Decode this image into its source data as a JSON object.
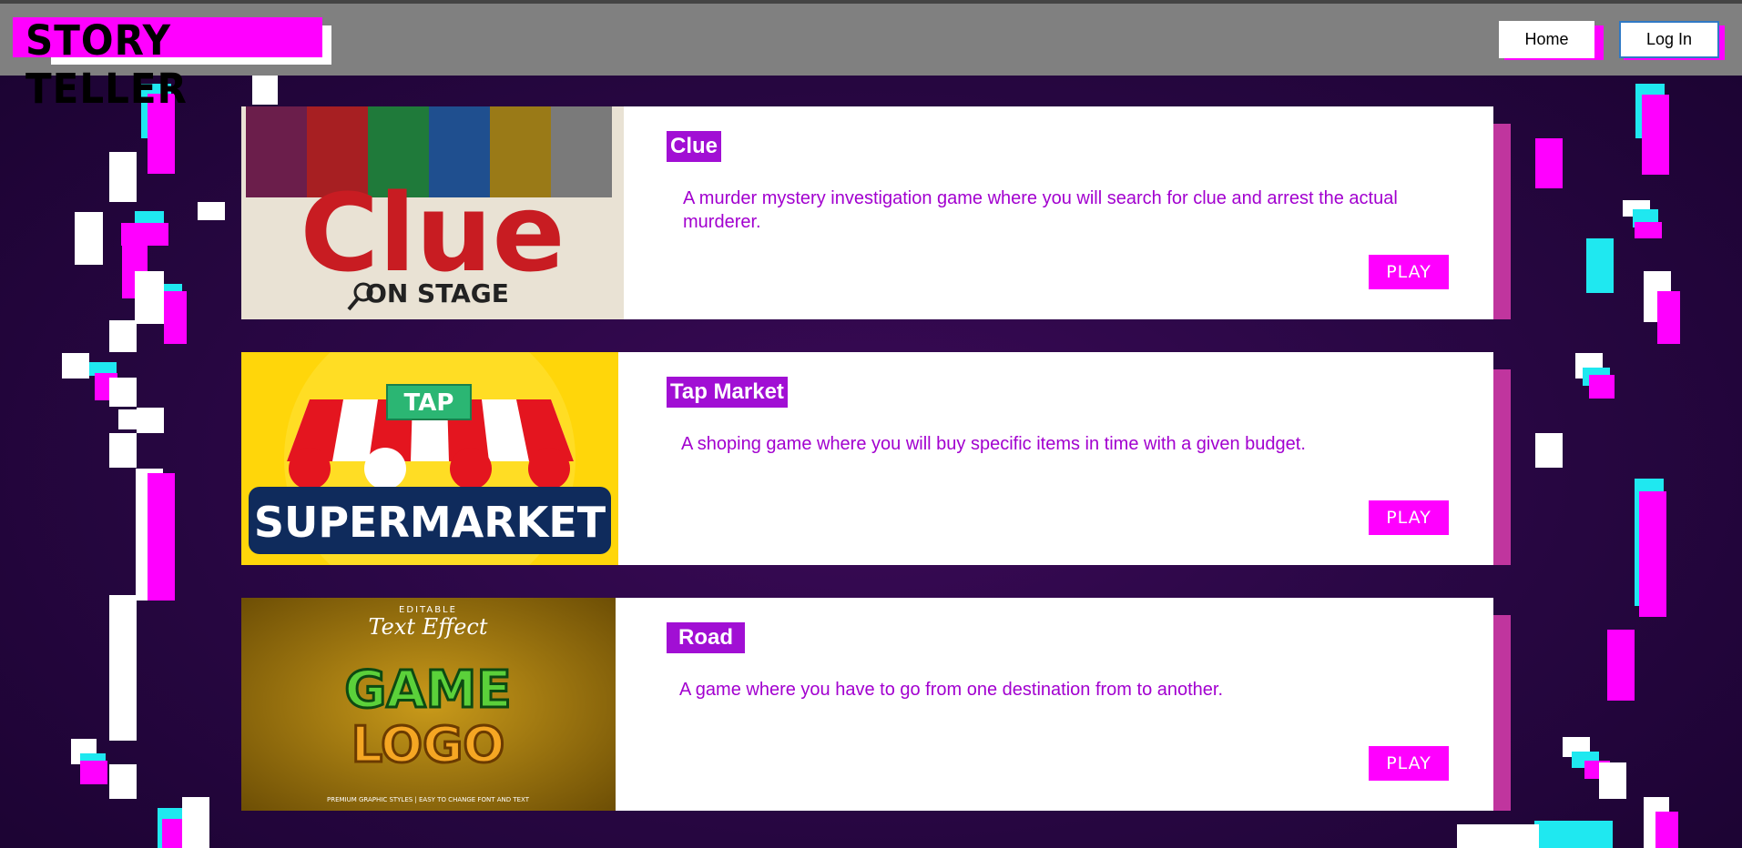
{
  "header": {
    "logo_text": "STORY TELLER",
    "nav": {
      "home": "Home",
      "login": "Log In"
    }
  },
  "games": [
    {
      "title": "Clue",
      "description": "A murder mystery investigation game where you will search for clue and arrest the actual murderer.",
      "play": "PLAY",
      "image_text": {
        "main": "Clue",
        "sub": "ON STAGE"
      }
    },
    {
      "title": "Tap Market",
      "description": "A shoping game where you will buy specific items in time with a given budget.",
      "play": "PLAY",
      "image_text": {
        "badge": "TAP",
        "main": "SUPERMARKET"
      }
    },
    {
      "title": "Road",
      "description": "A game where you have to go from one destination from to another.",
      "play": "PLAY",
      "image_text": {
        "top": "EDITABLE",
        "script": "Text Effect",
        "line1": "GAME",
        "line2": "LOGO",
        "footer": "PREMIUM GRAPHIC STYLES | EASY TO CHANGE FONT AND TEXT"
      }
    }
  ],
  "colors": {
    "accent": "#ff00ff",
    "title_bg": "#a10fd4",
    "description": "#a200cf",
    "card_shadow": "#c0359e",
    "header_bg": "#808080",
    "background": "#2a0745"
  }
}
